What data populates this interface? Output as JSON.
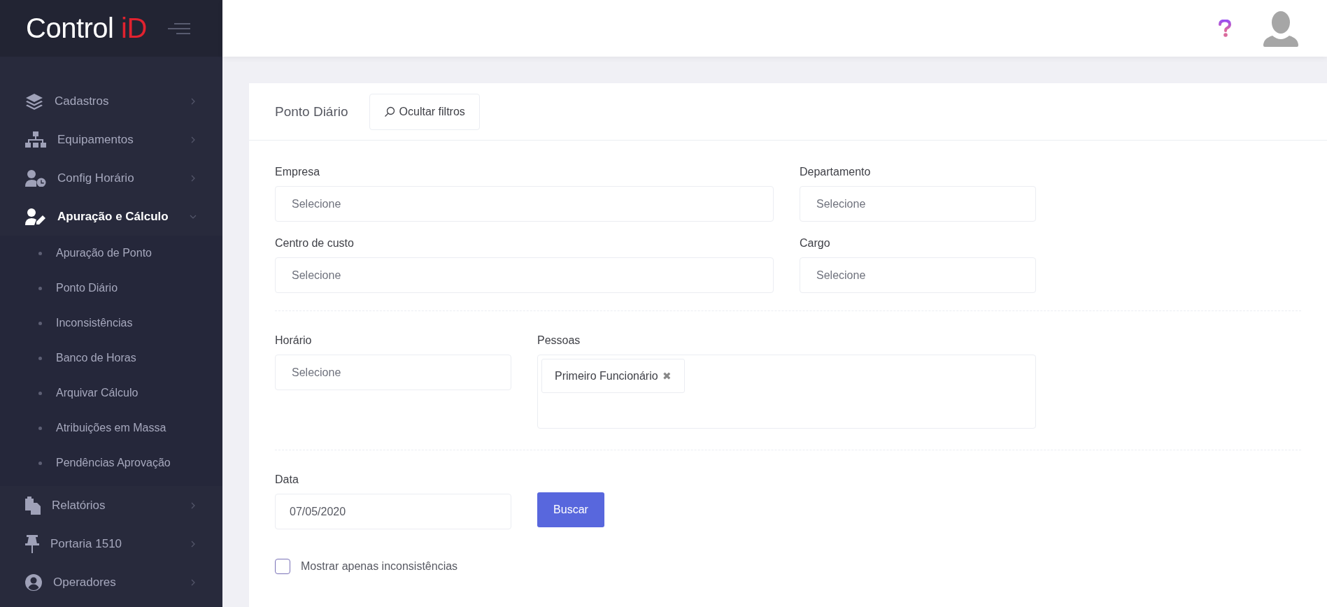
{
  "brand": {
    "text": "Control",
    "accent": "iD"
  },
  "sidebar": {
    "items": [
      {
        "label": "Cadastros",
        "expanded": false
      },
      {
        "label": "Equipamentos",
        "expanded": false
      },
      {
        "label": "Config Horário",
        "expanded": false
      },
      {
        "label": "Apuração e Cálculo",
        "expanded": true,
        "children": [
          {
            "label": "Apuração de Ponto"
          },
          {
            "label": "Ponto Diário"
          },
          {
            "label": "Inconsistências"
          },
          {
            "label": "Banco de Horas"
          },
          {
            "label": "Arquivar Cálculo"
          },
          {
            "label": "Atribuições em Massa"
          },
          {
            "label": "Pendências Aprovação"
          }
        ]
      },
      {
        "label": "Relatórios",
        "expanded": false
      },
      {
        "label": "Portaria 1510",
        "expanded": false
      },
      {
        "label": "Operadores",
        "expanded": false
      }
    ]
  },
  "card": {
    "title": "Ponto Diário",
    "filter_button": "Ocultar filtros",
    "filters": [
      {
        "label": "Empresa",
        "placeholder": "Selecione"
      },
      {
        "label": "Departamento",
        "placeholder": "Selecione"
      },
      {
        "label": "Centro de custo",
        "placeholder": "Selecione"
      },
      {
        "label": "Cargo",
        "placeholder": "Selecione"
      }
    ],
    "horario": {
      "label": "Horário",
      "placeholder": "Selecione"
    },
    "pessoas": {
      "label": "Pessoas",
      "tags": [
        {
          "label": "Primeiro Funcionário",
          "remove": "✖"
        }
      ]
    },
    "data": {
      "label": "Data",
      "value": "07/05/2020"
    },
    "search_button": "Buscar",
    "only_inconsistencies": {
      "label": "Mostrar apenas inconsistências",
      "checked": false
    }
  }
}
